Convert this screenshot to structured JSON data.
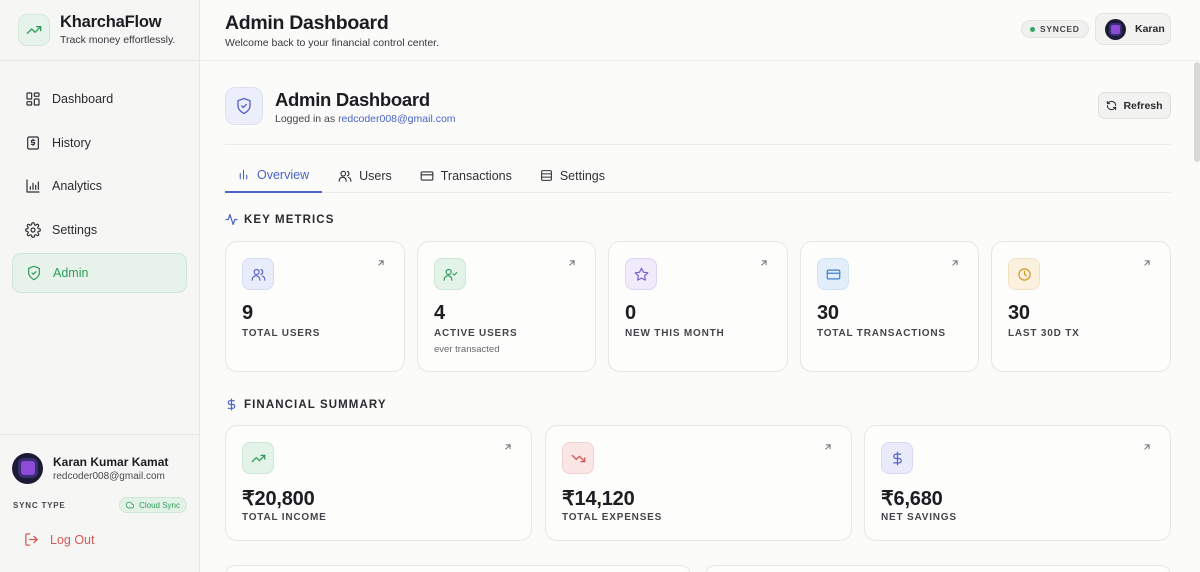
{
  "brand": {
    "name": "KharchaFlow",
    "tagline": "Track money effortlessly."
  },
  "sidebar": {
    "items": [
      {
        "label": "Dashboard",
        "icon": "dashboard-icon"
      },
      {
        "label": "History",
        "icon": "receipt-icon"
      },
      {
        "label": "Analytics",
        "icon": "bar-chart-icon"
      },
      {
        "label": "Settings",
        "icon": "gear-icon"
      },
      {
        "label": "Admin",
        "icon": "shield-icon",
        "active": true
      }
    ],
    "user": {
      "name": "Karan Kumar Kamat",
      "email": "redcoder008@gmail.com"
    },
    "sync": {
      "label": "SYNC TYPE",
      "value": "Cloud Sync"
    },
    "logout": "Log Out"
  },
  "header": {
    "title": "Admin Dashboard",
    "subtitle": "Welcome back to your financial control center.",
    "status": "SYNCED",
    "user_short": "Karan"
  },
  "admin": {
    "title": "Admin Dashboard",
    "logged_prefix": "Logged in as",
    "email": "redcoder008@gmail.com",
    "refresh": "Refresh"
  },
  "tabs": [
    {
      "label": "Overview",
      "active": true
    },
    {
      "label": "Users"
    },
    {
      "label": "Transactions"
    },
    {
      "label": "Settings"
    }
  ],
  "key_metrics": {
    "title": "KEY METRICS",
    "cards": [
      {
        "value": "9",
        "label": "TOTAL USERS",
        "icon": "users-icon"
      },
      {
        "value": "4",
        "label": "ACTIVE USERS",
        "note": "ever transacted",
        "icon": "user-check-icon"
      },
      {
        "value": "0",
        "label": "NEW THIS MONTH",
        "icon": "star-icon"
      },
      {
        "value": "30",
        "label": "TOTAL TRANSACTIONS",
        "icon": "credit-card-icon"
      },
      {
        "value": "30",
        "label": "LAST 30D TX",
        "icon": "clock-icon"
      }
    ]
  },
  "financial_summary": {
    "title": "FINANCIAL SUMMARY",
    "cards": [
      {
        "value": "₹20,800",
        "label": "TOTAL INCOME",
        "icon": "trending-up-icon"
      },
      {
        "value": "₹14,120",
        "label": "TOTAL EXPENSES",
        "icon": "trending-down-icon"
      },
      {
        "value": "₹6,680",
        "label": "NET SAVINGS",
        "icon": "dollar-icon"
      }
    ]
  },
  "colors": {
    "accent": "#4b63c9",
    "brand_green": "#2f9c5b",
    "danger": "#d45a55"
  }
}
